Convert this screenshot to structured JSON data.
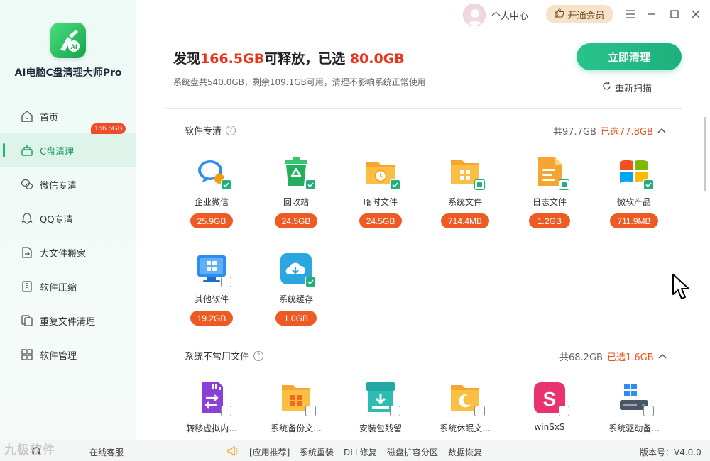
{
  "app": {
    "name": "AI电脑C盘清理大师Pro"
  },
  "topbar": {
    "user_center": "个人中心",
    "vip_label": "开通会员"
  },
  "sidebar": {
    "items": [
      {
        "label": "首页",
        "icon": "home-icon"
      },
      {
        "label": "C盘清理",
        "icon": "broom-icon",
        "badge": "166.5GB",
        "active": true
      },
      {
        "label": "微信专清",
        "icon": "wechat-icon"
      },
      {
        "label": "QQ专清",
        "icon": "qq-icon"
      },
      {
        "label": "大文件搬家",
        "icon": "file-move-icon"
      },
      {
        "label": "软件压缩",
        "icon": "compress-icon"
      },
      {
        "label": "重复文件清理",
        "icon": "duplicate-icon"
      },
      {
        "label": "软件管理",
        "icon": "apps-icon"
      }
    ]
  },
  "header": {
    "prefix": "发现",
    "found": "166.5GB",
    "mid": "可释放，已选 ",
    "selected": "80.0GB",
    "subline": "系统盘共540.0GB，剩余109.1GB可用，清理不影响系统正常使用",
    "clean_button": "立即清理",
    "rescan": "重新扫描"
  },
  "sections": [
    {
      "title": "软件专清",
      "total": "共97.7GB",
      "selected": "已选77.8GB",
      "tiles": [
        {
          "label": "企业微信",
          "size": "25.9GB",
          "state": "checked",
          "icon": "wecom-icon"
        },
        {
          "label": "回收站",
          "size": "24.5GB",
          "state": "checked",
          "icon": "recycle-bin-icon"
        },
        {
          "label": "临时文件",
          "size": "24.5GB",
          "state": "checked",
          "icon": "temp-folder-icon"
        },
        {
          "label": "系统文件",
          "size": "714.4MB",
          "state": "partial",
          "icon": "system-folder-icon"
        },
        {
          "label": "日志文件",
          "size": "1.2GB",
          "state": "partial",
          "icon": "log-file-icon"
        },
        {
          "label": "微软产品",
          "size": "711.9MB",
          "state": "checked",
          "icon": "microsoft-icon"
        },
        {
          "label": "其他软件",
          "size": "19.2GB",
          "state": "unchecked",
          "icon": "other-software-icon"
        },
        {
          "label": "系统缓存",
          "size": "1.0GB",
          "state": "checked",
          "icon": "system-cache-icon"
        }
      ]
    },
    {
      "title": "系统不常用文件",
      "total": "共68.2GB",
      "selected": "已选1.6GB",
      "tiles": [
        {
          "label": "转移虚拟内...",
          "state": "unchecked",
          "icon": "virtual-memory-icon"
        },
        {
          "label": "系统备份文...",
          "state": "unchecked",
          "icon": "backup-folder-icon"
        },
        {
          "label": "安装包残留",
          "state": "unchecked",
          "icon": "installer-icon"
        },
        {
          "label": "系统休眠文...",
          "state": "unchecked",
          "icon": "sleep-file-icon"
        },
        {
          "label": "winSxS",
          "state": "unchecked",
          "icon": "winsxs-icon"
        },
        {
          "label": "系统驱动备...",
          "state": "unchecked",
          "icon": "driver-backup-icon"
        }
      ]
    }
  ],
  "bottombar": {
    "service": "在线客服",
    "recommend": "[应用推荐]",
    "links": [
      "系统重装",
      "DLL修复",
      "磁盘扩容分区",
      "数据恢复"
    ],
    "version": "版本号：V4.0.0",
    "watermark": "九极软件"
  },
  "colors": {
    "accent": "#1eb07d",
    "highlight": "#e8341c",
    "size_pill": "#ee5a24",
    "vip": "#f6e2c8"
  }
}
